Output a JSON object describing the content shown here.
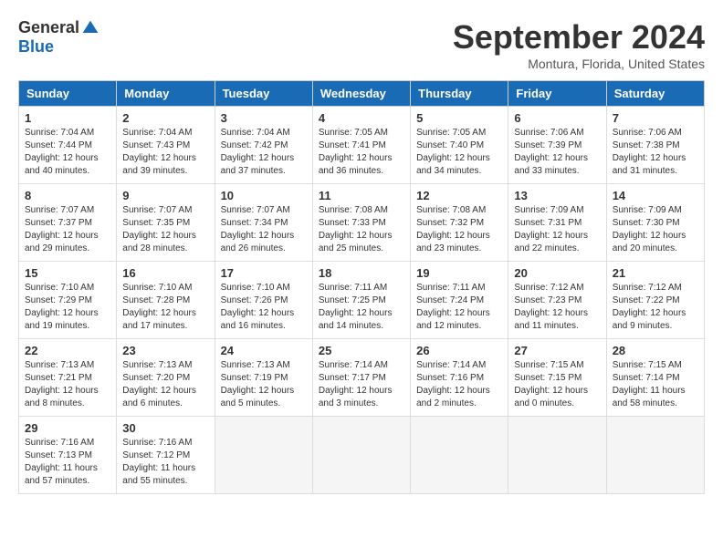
{
  "logo": {
    "general": "General",
    "blue": "Blue"
  },
  "title": "September 2024",
  "location": "Montura, Florida, United States",
  "headers": [
    "Sunday",
    "Monday",
    "Tuesday",
    "Wednesday",
    "Thursday",
    "Friday",
    "Saturday"
  ],
  "weeks": [
    [
      {
        "day": "1",
        "sunrise": "7:04 AM",
        "sunset": "7:44 PM",
        "daylight": "12 hours and 40 minutes."
      },
      {
        "day": "2",
        "sunrise": "7:04 AM",
        "sunset": "7:43 PM",
        "daylight": "12 hours and 39 minutes."
      },
      {
        "day": "3",
        "sunrise": "7:04 AM",
        "sunset": "7:42 PM",
        "daylight": "12 hours and 37 minutes."
      },
      {
        "day": "4",
        "sunrise": "7:05 AM",
        "sunset": "7:41 PM",
        "daylight": "12 hours and 36 minutes."
      },
      {
        "day": "5",
        "sunrise": "7:05 AM",
        "sunset": "7:40 PM",
        "daylight": "12 hours and 34 minutes."
      },
      {
        "day": "6",
        "sunrise": "7:06 AM",
        "sunset": "7:39 PM",
        "daylight": "12 hours and 33 minutes."
      },
      {
        "day": "7",
        "sunrise": "7:06 AM",
        "sunset": "7:38 PM",
        "daylight": "12 hours and 31 minutes."
      }
    ],
    [
      {
        "day": "8",
        "sunrise": "7:07 AM",
        "sunset": "7:37 PM",
        "daylight": "12 hours and 29 minutes."
      },
      {
        "day": "9",
        "sunrise": "7:07 AM",
        "sunset": "7:35 PM",
        "daylight": "12 hours and 28 minutes."
      },
      {
        "day": "10",
        "sunrise": "7:07 AM",
        "sunset": "7:34 PM",
        "daylight": "12 hours and 26 minutes."
      },
      {
        "day": "11",
        "sunrise": "7:08 AM",
        "sunset": "7:33 PM",
        "daylight": "12 hours and 25 minutes."
      },
      {
        "day": "12",
        "sunrise": "7:08 AM",
        "sunset": "7:32 PM",
        "daylight": "12 hours and 23 minutes."
      },
      {
        "day": "13",
        "sunrise": "7:09 AM",
        "sunset": "7:31 PM",
        "daylight": "12 hours and 22 minutes."
      },
      {
        "day": "14",
        "sunrise": "7:09 AM",
        "sunset": "7:30 PM",
        "daylight": "12 hours and 20 minutes."
      }
    ],
    [
      {
        "day": "15",
        "sunrise": "7:10 AM",
        "sunset": "7:29 PM",
        "daylight": "12 hours and 19 minutes."
      },
      {
        "day": "16",
        "sunrise": "7:10 AM",
        "sunset": "7:28 PM",
        "daylight": "12 hours and 17 minutes."
      },
      {
        "day": "17",
        "sunrise": "7:10 AM",
        "sunset": "7:26 PM",
        "daylight": "12 hours and 16 minutes."
      },
      {
        "day": "18",
        "sunrise": "7:11 AM",
        "sunset": "7:25 PM",
        "daylight": "12 hours and 14 minutes."
      },
      {
        "day": "19",
        "sunrise": "7:11 AM",
        "sunset": "7:24 PM",
        "daylight": "12 hours and 12 minutes."
      },
      {
        "day": "20",
        "sunrise": "7:12 AM",
        "sunset": "7:23 PM",
        "daylight": "12 hours and 11 minutes."
      },
      {
        "day": "21",
        "sunrise": "7:12 AM",
        "sunset": "7:22 PM",
        "daylight": "12 hours and 9 minutes."
      }
    ],
    [
      {
        "day": "22",
        "sunrise": "7:13 AM",
        "sunset": "7:21 PM",
        "daylight": "12 hours and 8 minutes."
      },
      {
        "day": "23",
        "sunrise": "7:13 AM",
        "sunset": "7:20 PM",
        "daylight": "12 hours and 6 minutes."
      },
      {
        "day": "24",
        "sunrise": "7:13 AM",
        "sunset": "7:19 PM",
        "daylight": "12 hours and 5 minutes."
      },
      {
        "day": "25",
        "sunrise": "7:14 AM",
        "sunset": "7:17 PM",
        "daylight": "12 hours and 3 minutes."
      },
      {
        "day": "26",
        "sunrise": "7:14 AM",
        "sunset": "7:16 PM",
        "daylight": "12 hours and 2 minutes."
      },
      {
        "day": "27",
        "sunrise": "7:15 AM",
        "sunset": "7:15 PM",
        "daylight": "12 hours and 0 minutes."
      },
      {
        "day": "28",
        "sunrise": "7:15 AM",
        "sunset": "7:14 PM",
        "daylight": "11 hours and 58 minutes."
      }
    ],
    [
      {
        "day": "29",
        "sunrise": "7:16 AM",
        "sunset": "7:13 PM",
        "daylight": "11 hours and 57 minutes."
      },
      {
        "day": "30",
        "sunrise": "7:16 AM",
        "sunset": "7:12 PM",
        "daylight": "11 hours and 55 minutes."
      },
      null,
      null,
      null,
      null,
      null
    ]
  ],
  "labels": {
    "sunrise": "Sunrise:",
    "sunset": "Sunset:",
    "daylight": "Daylight:"
  }
}
